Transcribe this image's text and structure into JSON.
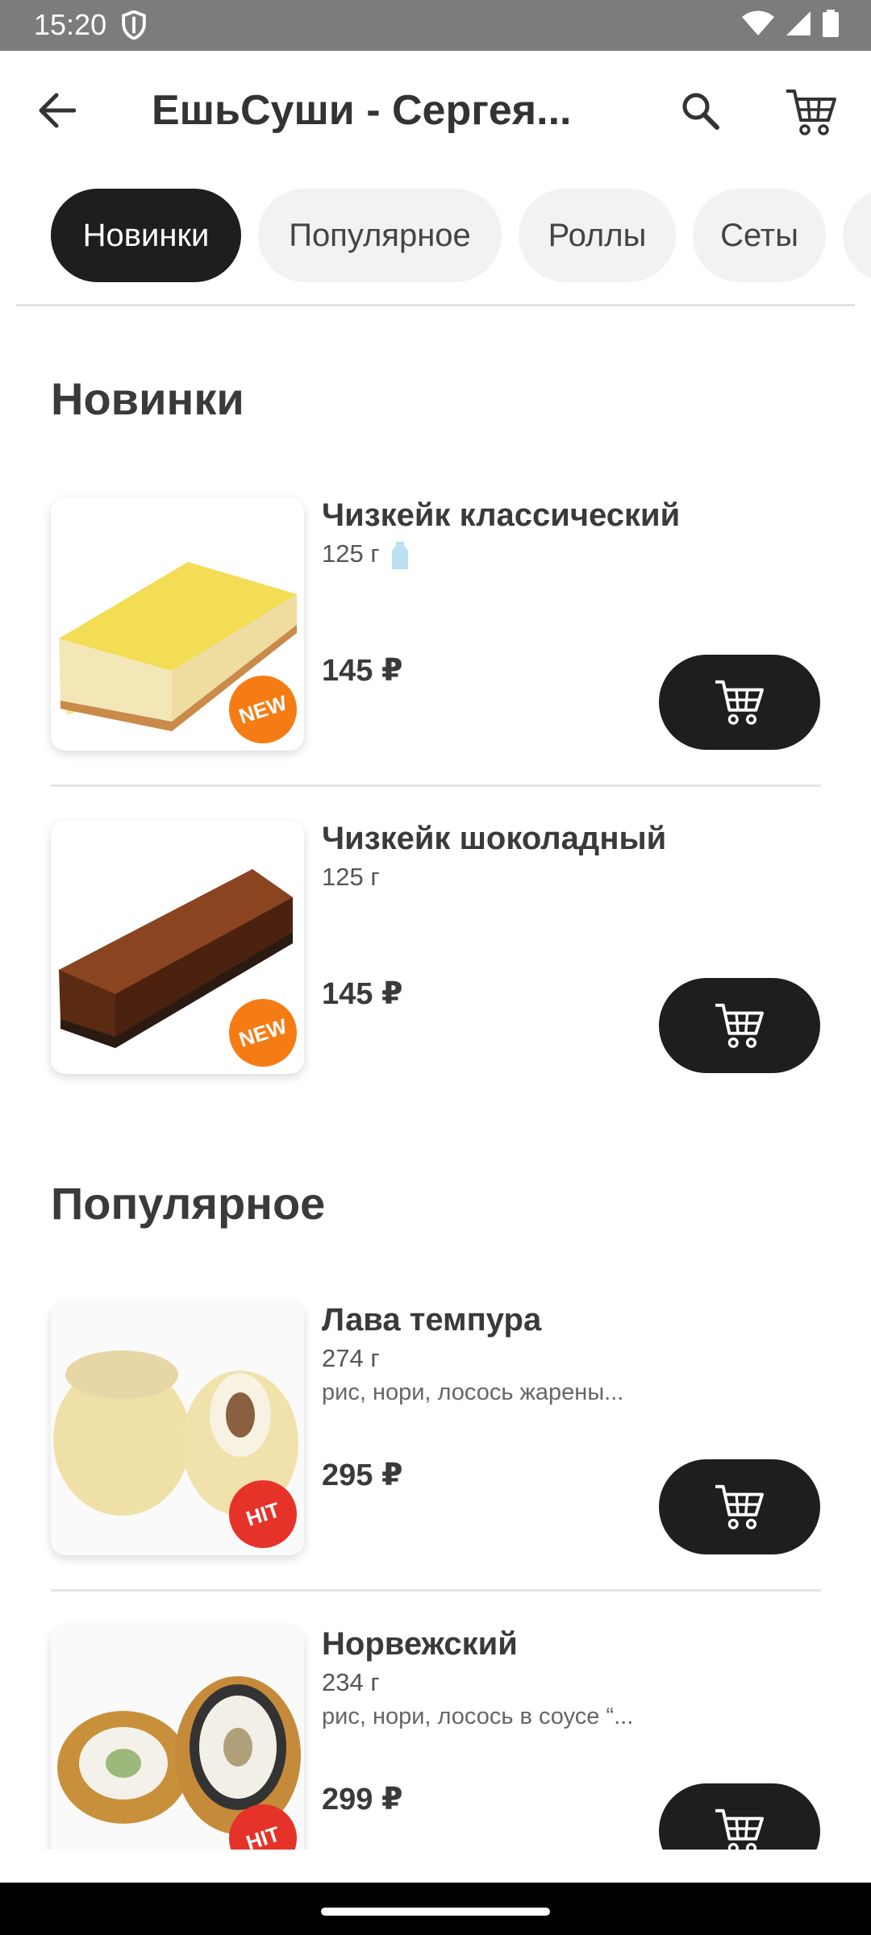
{
  "status": {
    "time": "15:20"
  },
  "header": {
    "title": "ЕшьСуши - Сергея..."
  },
  "tabs": [
    {
      "label": "Новинки",
      "active": true
    },
    {
      "label": "Популярное",
      "active": false
    },
    {
      "label": "Роллы",
      "active": false
    },
    {
      "label": "Сеты",
      "active": false
    }
  ],
  "sections": [
    {
      "title": "Новинки",
      "items": [
        {
          "name": "Чизкейк классический",
          "weight": "125 г",
          "description": "",
          "price": "145 ₽",
          "badge": "NEW"
        },
        {
          "name": "Чизкейк шоколадный",
          "weight": "125 г",
          "description": "",
          "price": "145 ₽",
          "badge": "NEW"
        }
      ]
    },
    {
      "title": "Популярное",
      "items": [
        {
          "name": "Лава темпура",
          "weight": "274 г",
          "description": "рис, нори, лосось жарены...",
          "price": "295 ₽",
          "badge": "HIT"
        },
        {
          "name": "Норвежский",
          "weight": "234 г",
          "description": "рис, нори, лосось в соусе “...",
          "price": "299 ₽",
          "badge": "HIT"
        }
      ]
    }
  ],
  "colors": {
    "new_badge": "#f57c14",
    "hit_badge": "#e53329",
    "button": "#1e1e1e",
    "active_tab": "#1e1e1e"
  }
}
